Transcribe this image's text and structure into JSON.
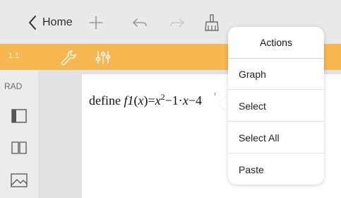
{
  "toolbar": {
    "back_label": "Home",
    "icons": [
      "chevron-left-icon",
      "plus-icon",
      "undo-icon",
      "redo-icon",
      "clear-brush-icon"
    ]
  },
  "tabbar": {
    "page_number": "1.1",
    "icons": [
      "wrench-icon",
      "sliders-icon"
    ],
    "background_color": "#f6b650"
  },
  "sidebar": {
    "angle_mode": "RAD",
    "icons": [
      "layout-icon",
      "book-icon",
      "image-icon"
    ]
  },
  "editor": {
    "expression": {
      "prefix": "define ",
      "func_name": "f1",
      "open_paren": "(",
      "arg": "x",
      "close_paren": ")=",
      "var1": "x",
      "exponent": "2",
      "tail": "−1·",
      "var2": "x",
      "trailing": "−4"
    }
  },
  "actions_menu": {
    "title": "Actions",
    "items": [
      {
        "label": "Graph"
      },
      {
        "label": "Select"
      },
      {
        "label": "Select All"
      },
      {
        "label": "Paste"
      }
    ]
  }
}
